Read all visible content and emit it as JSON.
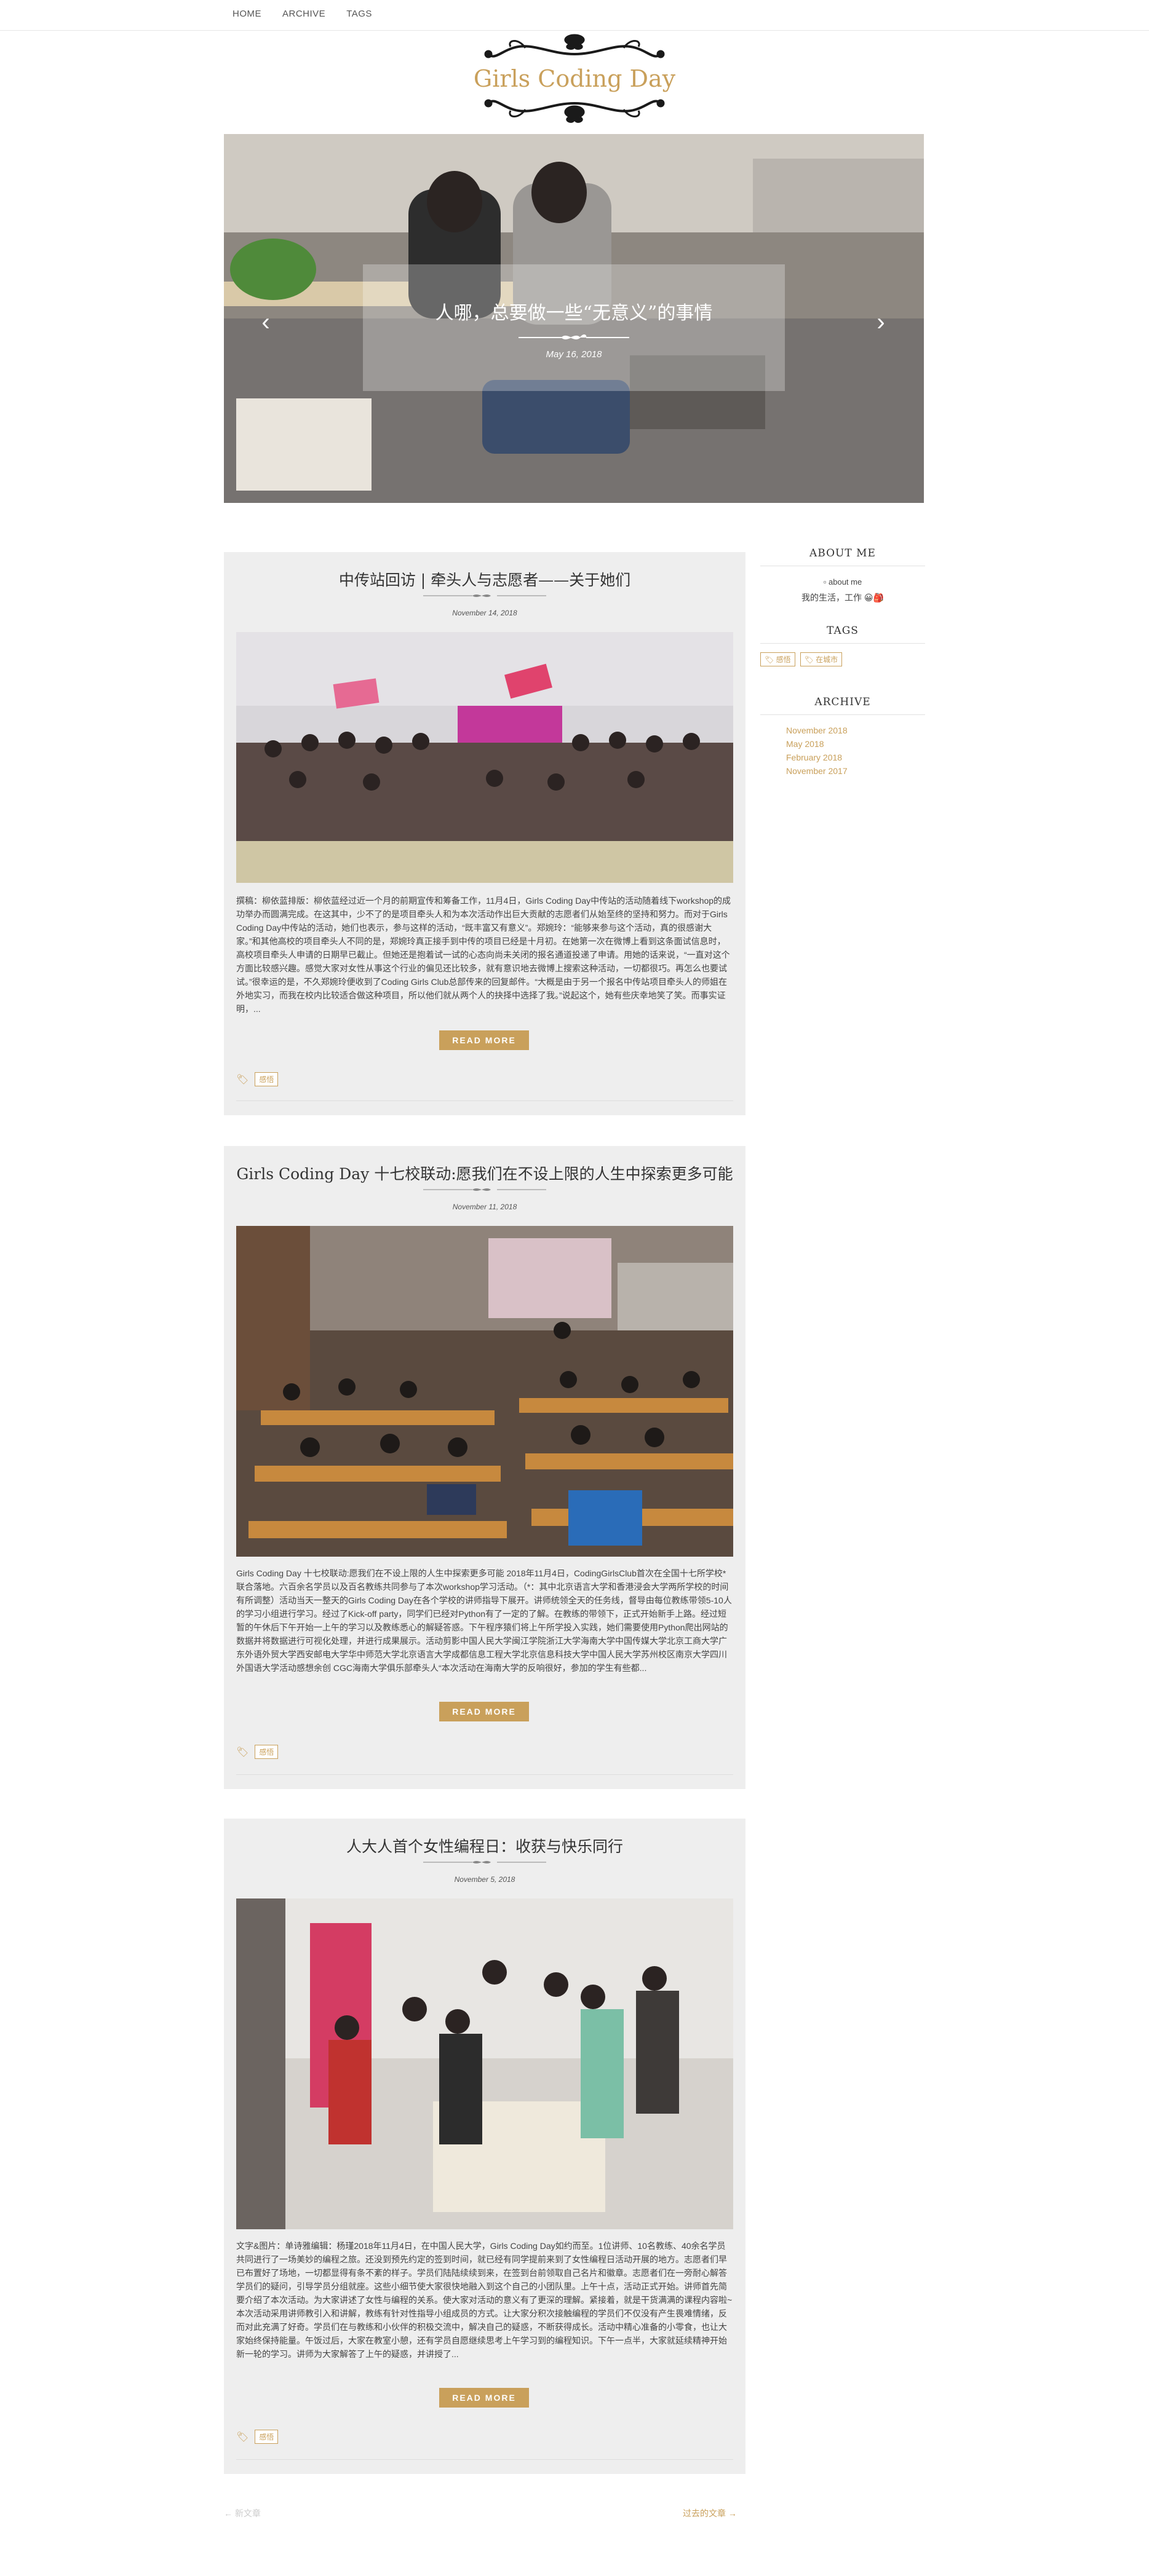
{
  "nav": {
    "items": [
      "HOME",
      "ARCHIVE",
      "TAGS"
    ]
  },
  "site": {
    "logo_text": "Girls Coding Day"
  },
  "carousel": {
    "slide_title": "人哪，总要做一些“无意义”的事情",
    "slide_date": "May 16, 2018",
    "prev_icon": "‹",
    "next_icon": "›"
  },
  "posts": [
    {
      "title": "中传站回访 | 牵头人与志愿者——关于她们",
      "date": "November 14, 2018",
      "excerpt": "撰稿：柳依蓝排版：柳依蓝经过近一个月的前期宣传和筹备工作，11月4日，Girls Coding Day中传站的活动随着线下workshop的成功举办而圆满完成。在这其中，少不了的是项目牵头人和为本次活动作出巨大贡献的志愿者们从始至终的坚持和努力。而对于Girls Coding Day中传站的活动，她们也表示，参与这样的活动，“既丰富又有意义”。郑婉玲：“能够来参与这个活动，真的很感谢大家。”和其他高校的项目牵头人不同的是，郑婉玲真正接手到中传的项目已经是十月初。在她第一次在微博上看到这条面试信息时，高校项目牵头人申请的日期早已截止。但她还是抱着试一试的心态向尚未关闭的报名通道投递了申请。用她的话来说，“一直对这个方面比较感兴趣。感觉大家对女性从事这个行业的偏见还比较多，就有意识地去微博上搜索这种活动，一切都很巧。再怎么也要试试。”很幸运的是，不久郑婉玲便收到了Coding Girls Club总部传来的回复邮件。“大概是由于另一个报名中传站项目牵头人的师姐在外地实习，而我在校内比较适合做这种项目，所以他们就从两个人的抉择中选择了我。”说起这个，她有些庆幸地笑了笑。而事实证明，...",
      "read_more": "READ MORE",
      "tags": [
        "感悟"
      ]
    },
    {
      "title": "Girls Coding Day 十七校联动:愿我们在不设上限的人生中探索更多可能",
      "date": "November 11, 2018",
      "excerpt": "Girls Coding Day 十七校联动:愿我们在不设上限的人生中探索更多可能 2018年11月4日，CodingGirlsClub首次在全国十七所学校*联合落地。六百余名学员以及百名教练共同参与了本次workshop学习活动。（*：其中北京语言大学和香港浸会大学两所学校的时间有所调整）活动当天一整天的Girls Coding Day在各个学校的讲师指导下展开。讲师统领全天的任务线，督导由每位教练带领5-10人的学习小组进行学习。经过了Kick-off party，同学们已经对Python有了一定的了解。在教练的带领下，正式开始新手上路。经过短暂的午休后下午开始一上午的学习以及教练悉心的解疑答惑。下午程序猿们将上午所学投入实践，她们需要使用Python爬出网站的数据并将数据进行可视化处理，并进行成果展示。活动剪影中国人民大学闽江学院浙江大学海南大学中国传媒大学北京工商大学广东外语外贸大学西安邮电大学华中师范大学北京语言大学成都信息工程大学北京信息科技大学中国人民大学苏州校区南京大学四川外国语大学活动感想余创 CGC海南大学俱乐部牵头人“本次活动在海南大学的反响很好，参加的学生有些都...",
      "read_more": "READ MORE",
      "tags": [
        "感悟"
      ]
    },
    {
      "title": "人大人首个女性编程日：收获与快乐同行",
      "date": "November 5, 2018",
      "excerpt": "文字&图片：单诗雅编辑：杨瑾2018年11月4日，在中国人民大学，Girls Coding Day如约而至。1位讲师、10名教练、40余名学员共同进行了一场美妙的编程之旅。还没到预先约定的签到时间，就已经有同学提前来到了女性编程日活动开展的地方。志愿者们早已布置好了场地，一切都显得有条不紊的样子。学员们陆陆续续到来，在签到台前领取自己名片和徽章。志愿者们在一旁耐心解答学员们的疑问，引导学员分组就座。这些小细节使大家很快地融入到这个自己的小团队里。上午十点，活动正式开始。讲师首先简要介绍了本次活动。为大家讲述了女性与编程的关系。使大家对活动的意义有了更深的理解。紧接着，就是干货满满的课程内容啦~本次活动采用讲师教引入和讲解，教练有针对性指导小组成员的方式。让大家分积次接触编程的学员们不仅没有产生畏难情绪，反而对此充满了好奇。学员们在与教练和小伙伴的积极交流中，解决自己的疑惑，不断获得成长。活动中精心准备的小零食，也让大家始终保持能量。午饭过后，大家在教室小憩，还有学员自愿继续思考上午学习到的编程知识。下午一点半，大家就延续精神开始新一轮的学习。讲师为大家解答了上午的疑惑，并讲授了...",
      "read_more": "READ MORE",
      "tags": [
        "感悟"
      ]
    }
  ],
  "sidebar": {
    "about_heading": "ABOUT ME",
    "about_alt": "about me",
    "about_text": "我的生活，工作 😀🎒",
    "tags_heading": "TAGS",
    "tags": [
      "感悟",
      "在城市"
    ],
    "archive_heading": "ARCHIVE",
    "archive": [
      "November 2018",
      "May 2018",
      "February 2018",
      "November 2017"
    ]
  },
  "pager": {
    "newer": "← 新文章",
    "older": "过去的文章 →"
  },
  "colors": {
    "accent": "#c9a05b",
    "card_bg": "#eeeeee"
  }
}
